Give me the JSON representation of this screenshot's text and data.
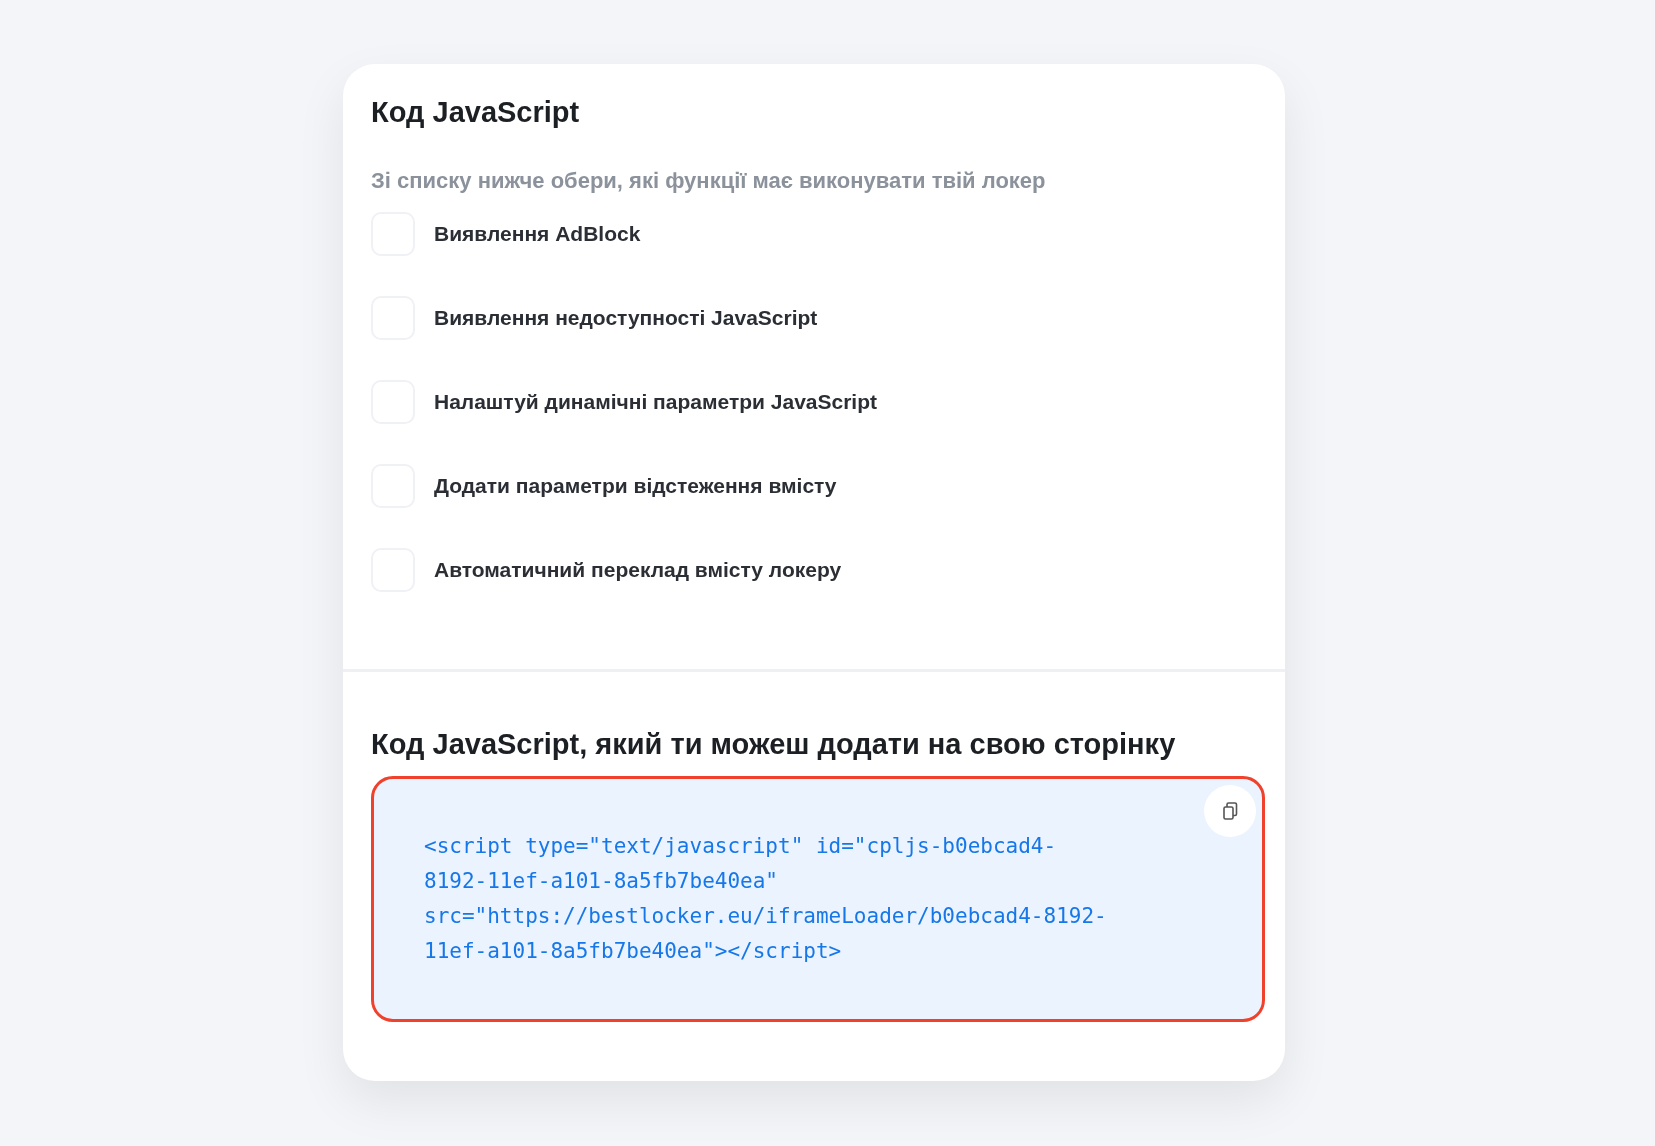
{
  "title": "Код JavaScript",
  "subtitle": "Зі списку нижче обери, які функції має виконувати твій локер",
  "options": [
    {
      "label": "Виявлення AdBlock",
      "checked": false
    },
    {
      "label": "Виявлення недоступності JavaScript",
      "checked": false
    },
    {
      "label": "Налаштуй динамічні параметри JavaScript",
      "checked": false
    },
    {
      "label": "Додати параметри відстеження вмісту",
      "checked": false
    },
    {
      "label": "Автоматичний переклад вмісту локеру",
      "checked": false
    }
  ],
  "code_section": {
    "title": "Код JavaScript, який ти можеш додати на свою сторінку",
    "code_lines": [
      "<script type=\"text/javascript\" id=\"cpljs-b0ebcad4-",
      "8192-11ef-a101-8a5fb7be40ea\"",
      "src=\"https://bestlocker.eu/iframeLoader/b0ebcad4-8192-",
      "11ef-a101-8a5fb7be40ea\"></script>"
    ]
  }
}
